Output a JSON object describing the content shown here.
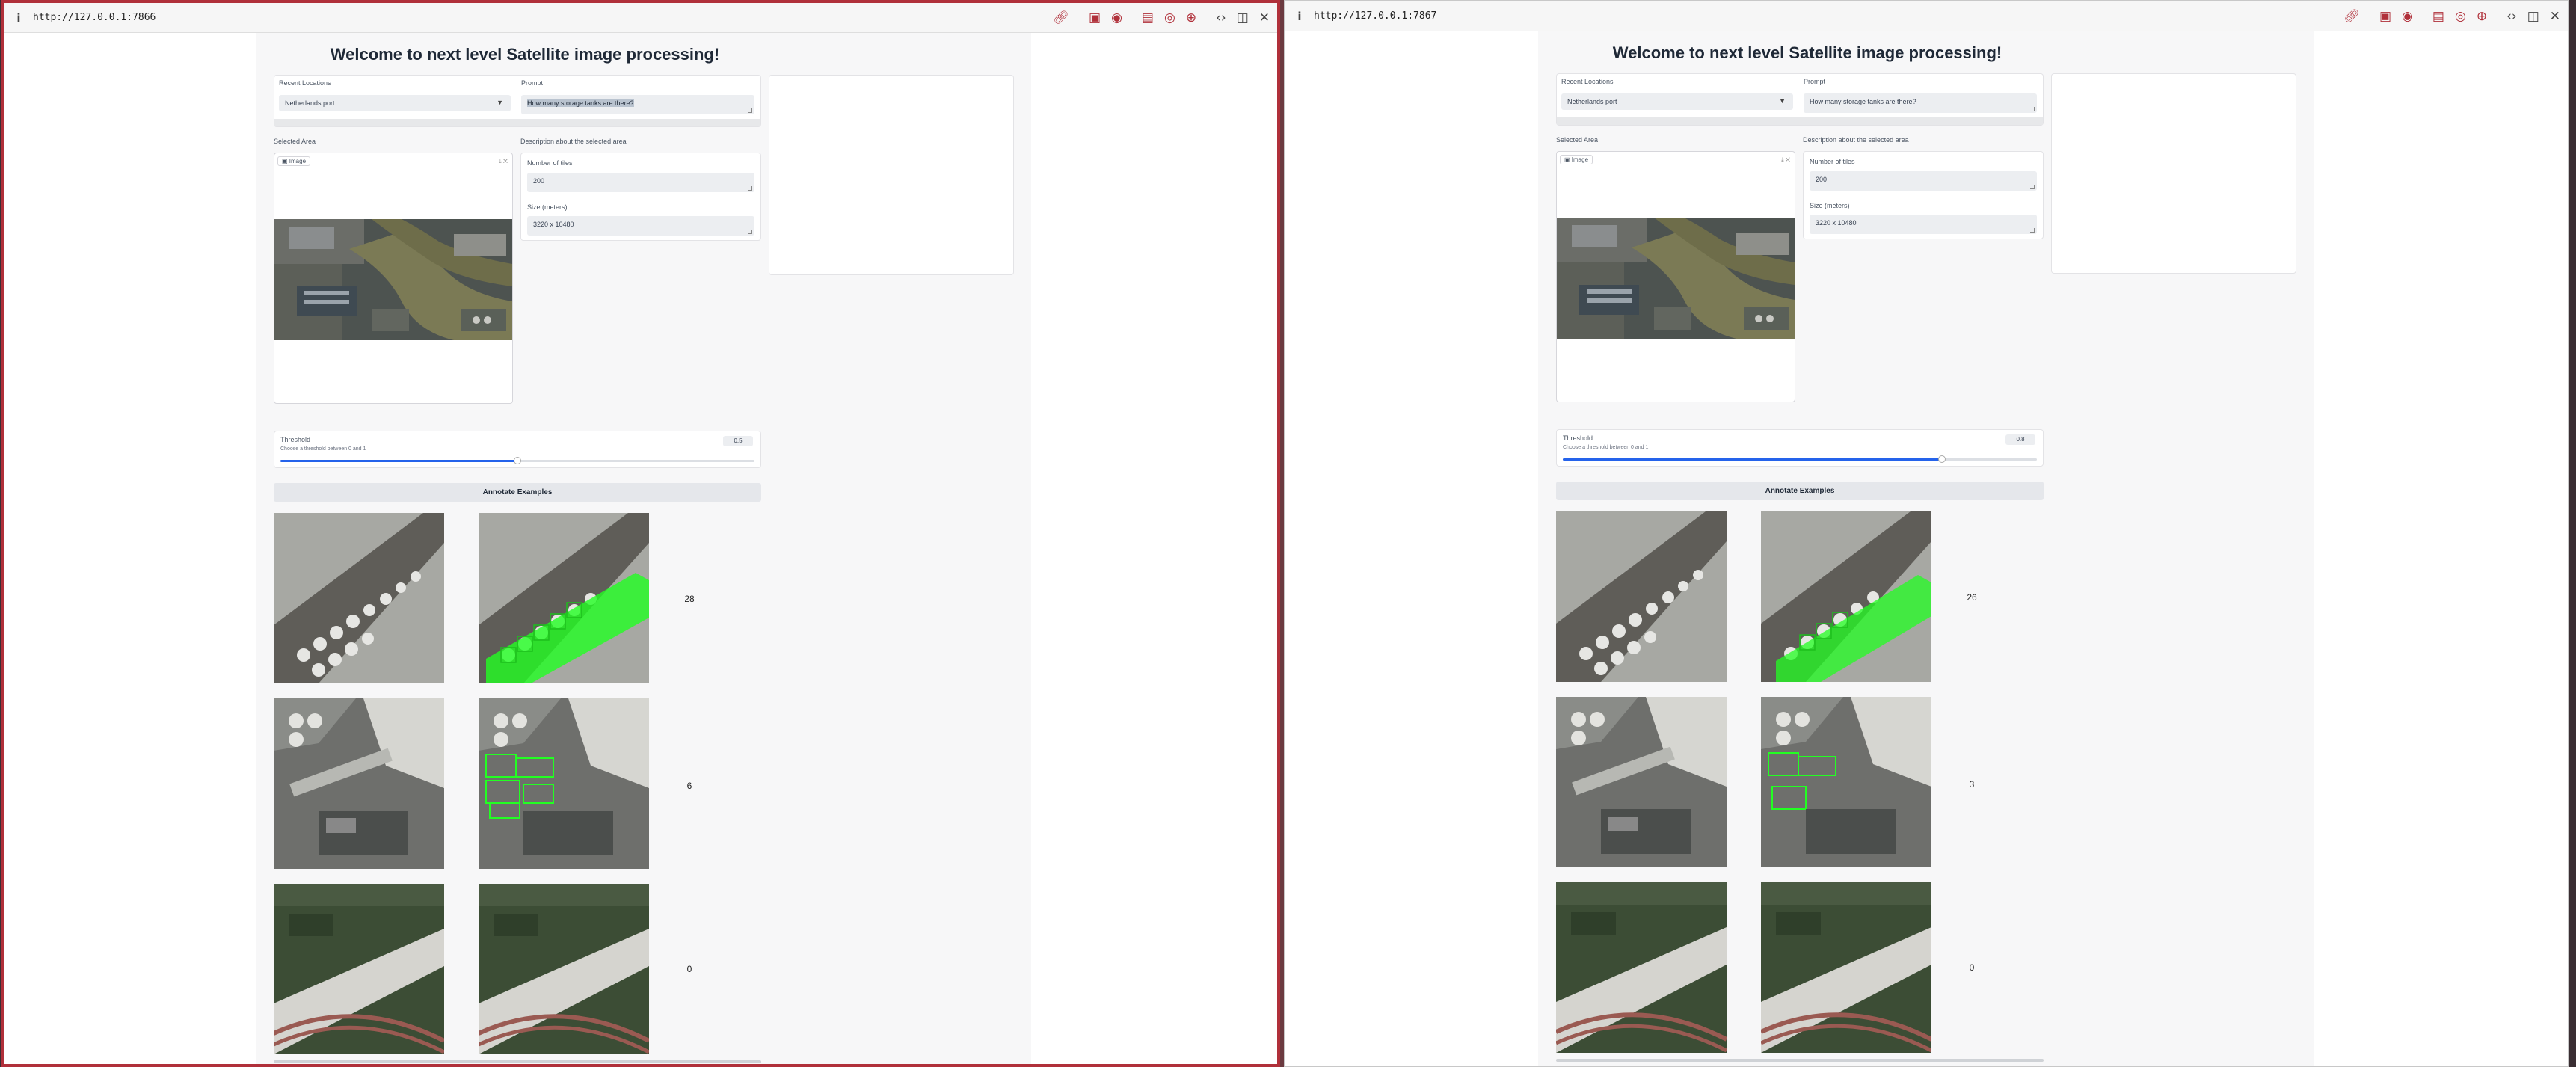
{
  "windows": [
    {
      "url": "http://127.0.0.1:7866",
      "heading": "Welcome to next level Satellite image processing!",
      "recent_locations_label": "Recent Locations",
      "recent_locations_value": "Netherlands port",
      "prompt_label": "Prompt",
      "prompt_value": "How many storage tanks are there?",
      "selected_area_label": "Selected Area",
      "description_label": "Description about the selected area",
      "image_tag": "Image",
      "num_tiles_label": "Number of tiles",
      "num_tiles_value": "200",
      "size_label": "Size (meters)",
      "size_value": "3220 x 10480",
      "threshold_label": "Threshold",
      "threshold_info": "Choose a threshold between 0 and 1",
      "threshold_value": "0.5",
      "threshold_level": 0.5,
      "annotate_button": "Annotate Examples",
      "counts": [
        "28",
        "6",
        "0"
      ]
    },
    {
      "url": "http://127.0.0.1:7867",
      "heading": "Welcome to next level Satellite image processing!",
      "recent_locations_label": "Recent Locations",
      "recent_locations_value": "Netherlands port",
      "prompt_label": "Prompt",
      "prompt_value": "How many storage tanks are there?",
      "selected_area_label": "Selected Area",
      "description_label": "Description about the selected area",
      "image_tag": "Image",
      "num_tiles_label": "Number of tiles",
      "num_tiles_value": "200",
      "size_label": "Size (meters)",
      "size_value": "3220 x 10480",
      "threshold_label": "Threshold",
      "threshold_info": "Choose a threshold between 0 and 1",
      "threshold_value": "0.8",
      "threshold_level": 0.8,
      "annotate_button": "Annotate Examples",
      "counts": [
        "26",
        "3",
        "0"
      ]
    }
  ],
  "icons": [
    "info-icon",
    "link-icon",
    "screenshot-icon",
    "camera-icon",
    "window-icon",
    "color-picker-icon",
    "crosshair-icon",
    "code-icon",
    "split-icon",
    "close-icon"
  ],
  "colors": {
    "accent": "#2563eb",
    "window_border_active": "#b0303a",
    "detection_box": "#22ff22"
  }
}
